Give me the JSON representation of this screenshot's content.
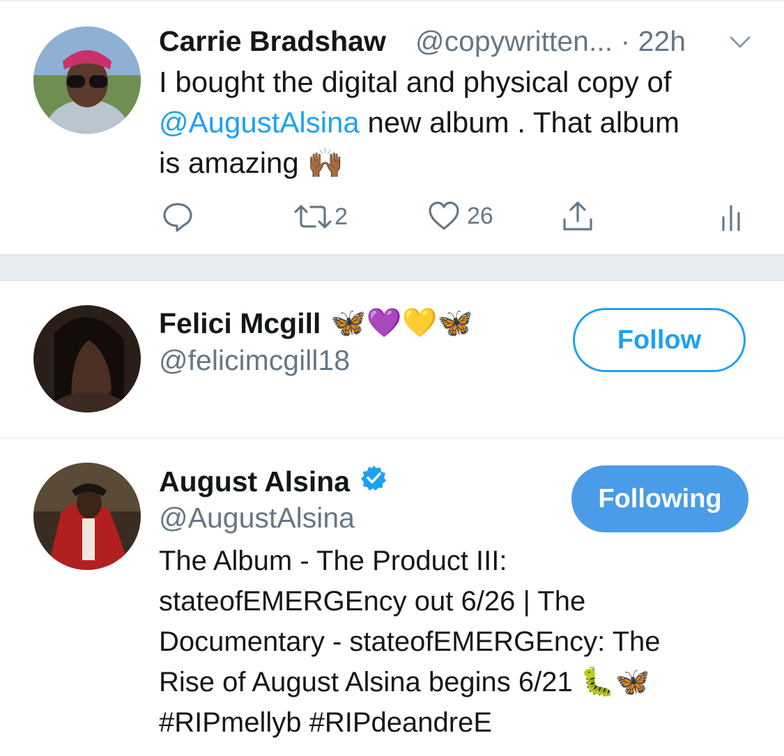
{
  "tweet": {
    "author_name": "Carrie Bradshaw",
    "author_handle": "@copywritten...",
    "separator": "·",
    "time": "22h",
    "text_part1": "I bought the digital and physical copy of",
    "mention": "@AugustAlsina",
    "text_part2": " new album  . That album",
    "text_part3": "is amazing",
    "emoji": "🙌🏾",
    "actions": {
      "reply_count": "",
      "retweet_count": "2",
      "like_count": "26"
    }
  },
  "suggestions": [
    {
      "name": "Felici Mcgill",
      "emojis": "🦋💜💛🦋",
      "handle": "@felicimcgill18",
      "button_label": "Follow"
    },
    {
      "name": "August Alsina",
      "handle": "@AugustAlsina",
      "button_label": "Following",
      "bio_lines": [
        "The Album - The Product III:",
        "stateofEMERGEncy out 6/26 | The",
        "Documentary - stateofEMERGEncy: The",
        "Rise of August Alsina begins 6/21 🐛🦋",
        "#RIPmellyb #RIPdeandreE"
      ]
    }
  ],
  "colors": {
    "accent": "#1da1f2",
    "following_bg": "#4a9be8",
    "muted": "#657786",
    "verified": "#1da1f2"
  },
  "icons": [
    "reply-icon",
    "retweet-icon",
    "like-icon",
    "share-icon",
    "analytics-icon",
    "chevron-down-icon",
    "verified-icon"
  ]
}
